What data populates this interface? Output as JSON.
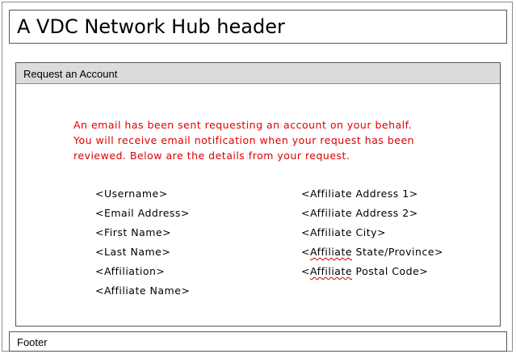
{
  "header": {
    "title": "A VDC Network Hub header"
  },
  "panel": {
    "title": "Request an Account",
    "message": [
      "An email has been sent requesting an account on your behalf.",
      "You will receive email notification when your request has been",
      "reviewed.  Below are the details from your request."
    ]
  },
  "fields": {
    "left": [
      "<Username>",
      "<Email Address>",
      "<First Name>",
      "<Last Name>",
      "<Affiliation>",
      "<Affiliate Name>"
    ],
    "right": [
      "<Affiliate Address 1>",
      "<Affiliate Address 2>",
      "<Affiliate City>",
      {
        "prefix": "<",
        "underlined": "Affiliate",
        "suffix": " State/Province>"
      },
      {
        "prefix": "<",
        "underlined": "Affiliate",
        "suffix": " Postal Code>"
      }
    ]
  },
  "footer": {
    "text": "Footer"
  },
  "colors": {
    "message": "#dd0000",
    "panel_header_bg": "#dcdcdc",
    "border": "#555555"
  }
}
